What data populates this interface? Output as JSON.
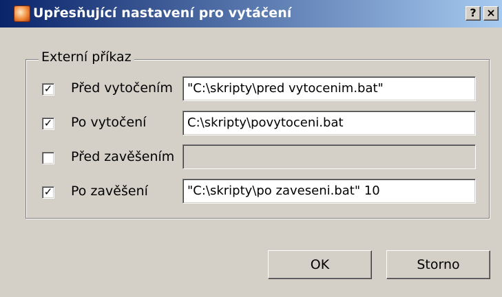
{
  "window": {
    "title": "Upřesňující nastavení pro vytáčení",
    "help_label": "?",
    "close_label": "×"
  },
  "group": {
    "label": "Externí příkaz",
    "rows": [
      {
        "label": "Před vytočením",
        "checked": true,
        "value": "\"C:\\skripty\\pred vytocenim.bat\"",
        "enabled": true
      },
      {
        "label": "Po vytočení",
        "checked": true,
        "value": "C:\\skripty\\povytoceni.bat",
        "enabled": true
      },
      {
        "label": "Před zavěšením",
        "checked": false,
        "value": "",
        "enabled": false
      },
      {
        "label": "Po zavěšení",
        "checked": true,
        "value": "\"C:\\skripty\\po zaveseni.bat\" 10",
        "enabled": true
      }
    ]
  },
  "buttons": {
    "ok_label": "OK",
    "cancel_label": "Storno"
  }
}
